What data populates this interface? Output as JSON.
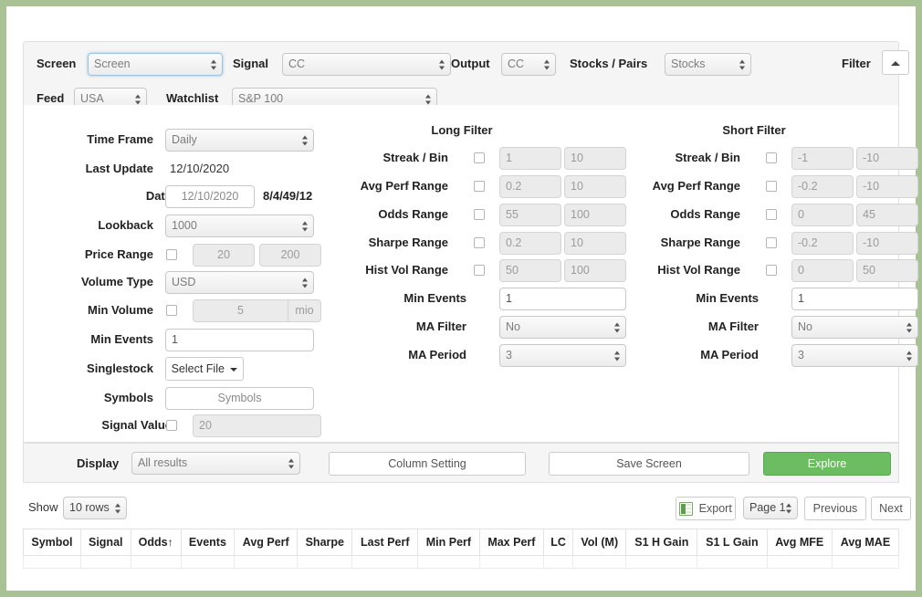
{
  "topbar": {
    "screen_label": "Screen",
    "screen_value": "Screen",
    "signal_label": "Signal",
    "signal_value": "CC",
    "output_label": "Output",
    "output_value": "CC",
    "stocks_pairs_label": "Stocks / Pairs",
    "stocks_pairs_value": "Stocks",
    "filter_label": "Filter",
    "collapse_icon": "chevron-up-icon",
    "feed_label": "Feed",
    "feed_value": "USA",
    "watchlist_label": "Watchlist",
    "watchlist_value": "S&P 100"
  },
  "general": {
    "time_frame_label": "Time Frame",
    "time_frame_value": "Daily",
    "last_update_label": "Last Update",
    "last_update_value": "12/10/2020",
    "date_label": "Date",
    "date_value": "12/10/2020",
    "date_suffix": "8/4/49/12",
    "lookback_label": "Lookback",
    "lookback_value": "1000",
    "price_range_label": "Price Range",
    "price_range_min": "20",
    "price_range_max": "200",
    "volume_type_label": "Volume Type",
    "volume_type_value": "USD",
    "min_volume_label": "Min Volume",
    "min_volume_value": "5",
    "min_volume_unit": "mio",
    "min_events_label": "Min Events",
    "min_events_value": "1",
    "singlestock_label": "Singlestock",
    "singlestock_button": "Select File",
    "symbols_label": "Symbols",
    "symbols_placeholder": "Symbols",
    "signal_value_label": "Signal Value",
    "signal_value_value": "20"
  },
  "long_filter": {
    "title": "Long Filter",
    "rows": [
      {
        "label": "Streak / Bin",
        "min": "1",
        "max": "10"
      },
      {
        "label": "Avg Perf Range",
        "min": "0.2",
        "max": "10"
      },
      {
        "label": "Odds Range",
        "min": "55",
        "max": "100"
      },
      {
        "label": "Sharpe Range",
        "min": "0.2",
        "max": "10"
      },
      {
        "label": "Hist Vol Range",
        "min": "50",
        "max": "100"
      }
    ],
    "min_events_label": "Min Events",
    "min_events_value": "1",
    "ma_filter_label": "MA Filter",
    "ma_filter_value": "No",
    "ma_period_label": "MA Period",
    "ma_period_value": "3"
  },
  "short_filter": {
    "title": "Short Filter",
    "rows": [
      {
        "label": "Streak / Bin",
        "min": "-1",
        "max": "-10"
      },
      {
        "label": "Avg Perf Range",
        "min": "-0.2",
        "max": "-10"
      },
      {
        "label": "Odds Range",
        "min": "0",
        "max": "45"
      },
      {
        "label": "Sharpe Range",
        "min": "-0.2",
        "max": "-10"
      },
      {
        "label": "Hist Vol Range",
        "min": "0",
        "max": "50"
      }
    ],
    "min_events_label": "Min Events",
    "min_events_value": "1",
    "ma_filter_label": "MA Filter",
    "ma_filter_value": "No",
    "ma_period_label": "MA Period",
    "ma_period_value": "3"
  },
  "display_bar": {
    "display_label": "Display",
    "display_value": "All results",
    "column_setting_button": "Column Setting",
    "save_screen_button": "Save Screen",
    "explore_button": "Explore",
    "explore_color": "#6cbd62"
  },
  "pager": {
    "show_label": "Show",
    "rows_value": "10 rows",
    "export_icon": "excel-icon",
    "export_label": "Export",
    "page_value": "Page 1",
    "previous_label": "Previous",
    "next_label": "Next"
  },
  "table": {
    "sort_icon": "↑",
    "columns": [
      "Symbol",
      "Signal",
      "Odds",
      "Events",
      "Avg Perf",
      "Sharpe",
      "Last Perf",
      "Min Perf",
      "Max Perf",
      "LC",
      "Vol (M)",
      "S1 H Gain",
      "S1 L Gain",
      "Avg MFE",
      "Avg MAE"
    ],
    "sorted_column": "Odds"
  },
  "theme": {
    "page_border": "#a9c295",
    "accent_green": "#6cbd62"
  }
}
